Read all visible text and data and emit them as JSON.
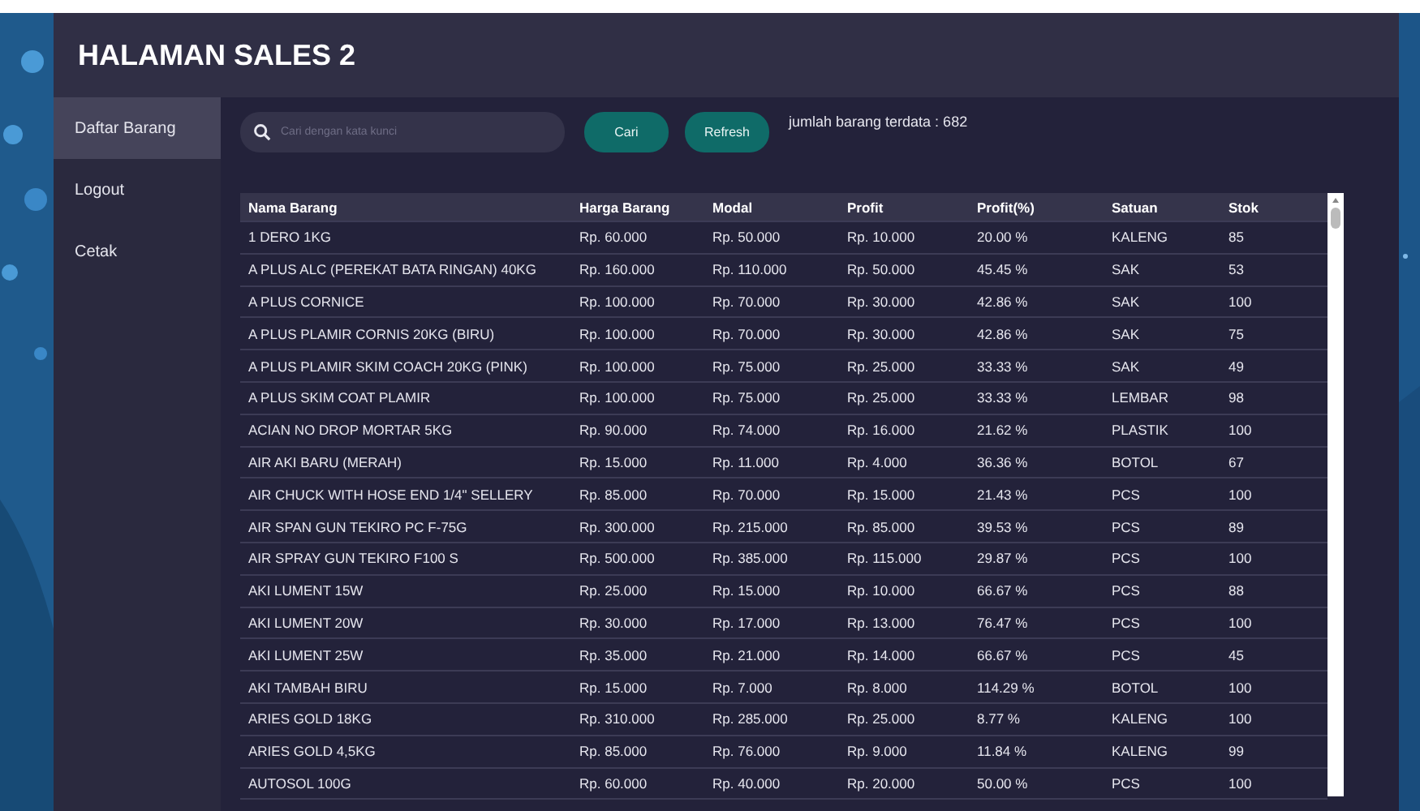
{
  "window": {
    "title": "HALAMAN SALES 2"
  },
  "sidebar": {
    "items": [
      {
        "label": "Daftar Barang",
        "selected": true
      },
      {
        "label": "Logout",
        "selected": false
      },
      {
        "label": "Cetak",
        "selected": false
      }
    ]
  },
  "search": {
    "placeholder": "Cari dengan kata kunci"
  },
  "buttons": [
    "Cari",
    "Refresh"
  ],
  "count_label": "jumlah barang terdata : 682",
  "table": {
    "columns": [
      "Nama Barang",
      "Harga Barang",
      "Modal",
      "Profit",
      "Profit(%)",
      "Satuan",
      "Stok"
    ],
    "rows": [
      [
        "1 DERO 1KG",
        "Rp. 60.000",
        "Rp. 50.000",
        "Rp. 10.000",
        "20.00 %",
        "KALENG",
        "85"
      ],
      [
        "A PLUS ALC (PEREKAT BATA RINGAN) 40KG",
        "Rp. 160.000",
        "Rp. 110.000",
        "Rp. 50.000",
        "45.45 %",
        "SAK",
        "53"
      ],
      [
        "A PLUS CORNICE",
        "Rp. 100.000",
        "Rp. 70.000",
        "Rp. 30.000",
        "42.86 %",
        "SAK",
        "100"
      ],
      [
        "A PLUS PLAMIR CORNIS 20KG (BIRU)",
        "Rp. 100.000",
        "Rp. 70.000",
        "Rp. 30.000",
        "42.86 %",
        "SAK",
        "75"
      ],
      [
        "A PLUS PLAMIR SKIM COACH 20KG (PINK)",
        "Rp. 100.000",
        "Rp. 75.000",
        "Rp. 25.000",
        "33.33 %",
        "SAK",
        "49"
      ],
      [
        "A PLUS SKIM COAT PLAMIR",
        "Rp. 100.000",
        "Rp. 75.000",
        "Rp. 25.000",
        "33.33 %",
        "LEMBAR",
        "98"
      ],
      [
        "ACIAN NO DROP MORTAR 5KG",
        "Rp. 90.000",
        "Rp. 74.000",
        "Rp. 16.000",
        "21.62 %",
        "PLASTIK",
        "100"
      ],
      [
        "AIR AKI BARU (MERAH)",
        "Rp. 15.000",
        "Rp. 11.000",
        "Rp. 4.000",
        "36.36 %",
        "BOTOL",
        "67"
      ],
      [
        "AIR CHUCK WITH HOSE END 1/4\" SELLERY",
        "Rp. 85.000",
        "Rp. 70.000",
        "Rp. 15.000",
        "21.43 %",
        "PCS",
        "100"
      ],
      [
        "AIR SPAN GUN TEKIRO PC F-75G",
        "Rp. 300.000",
        "Rp. 215.000",
        "Rp. 85.000",
        "39.53 %",
        "PCS",
        "89"
      ],
      [
        "AIR SPRAY GUN TEKIRO F100 S",
        "Rp. 500.000",
        "Rp. 385.000",
        "Rp. 115.000",
        "29.87 %",
        "PCS",
        "100"
      ],
      [
        "AKI LUMENT 15W",
        "Rp. 25.000",
        "Rp. 15.000",
        "Rp. 10.000",
        "66.67 %",
        "PCS",
        "88"
      ],
      [
        "AKI LUMENT 20W",
        "Rp. 30.000",
        "Rp. 17.000",
        "Rp. 13.000",
        "76.47 %",
        "PCS",
        "100"
      ],
      [
        "AKI LUMENT 25W",
        "Rp. 35.000",
        "Rp. 21.000",
        "Rp. 14.000",
        "66.67 %",
        "PCS",
        "45"
      ],
      [
        "AKI TAMBAH BIRU",
        "Rp. 15.000",
        "Rp. 7.000",
        "Rp. 8.000",
        "114.29 %",
        "BOTOL",
        "100"
      ],
      [
        "ARIES GOLD 18KG",
        "Rp. 310.000",
        "Rp. 285.000",
        "Rp. 25.000",
        "8.77 %",
        "KALENG",
        "100"
      ],
      [
        "ARIES GOLD 4,5KG",
        "Rp. 85.000",
        "Rp. 76.000",
        "Rp. 9.000",
        "11.84 %",
        "KALENG",
        "99"
      ],
      [
        "AUTOSOL 100G",
        "Rp. 60.000",
        "Rp. 40.000",
        "Rp. 20.000",
        "50.00 %",
        "PCS",
        "100"
      ]
    ]
  }
}
